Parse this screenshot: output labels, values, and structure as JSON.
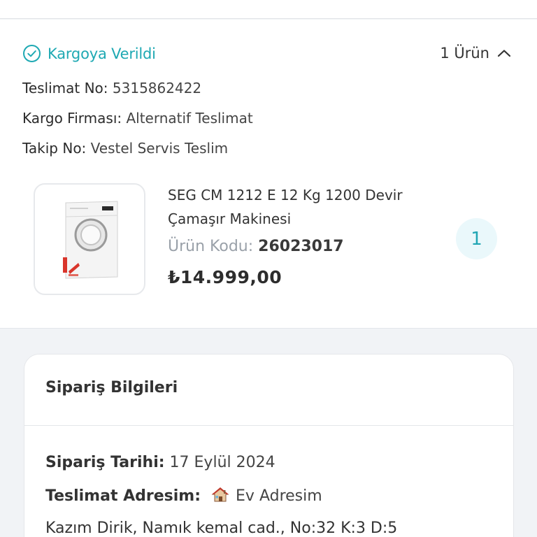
{
  "shipment": {
    "status": "Kargoya Verildi",
    "item_count": "1 Ürün",
    "delivery_no_label": "Teslimat No:",
    "delivery_no": "5315862422",
    "carrier_label": "Kargo Firması:",
    "carrier": "Alternatif Teslimat",
    "tracking_label": "Takip No:",
    "tracking": "Vestel Servis Teslim"
  },
  "product": {
    "name": "SEG CM 1212 E 12 Kg 1200 Devir Çamaşır Makinesi",
    "code_label": "Ürün Kodu:",
    "code": "26023017",
    "price": "₺14.999,00",
    "quantity": "1"
  },
  "order": {
    "title": "Sipariş Bilgileri",
    "date_label": "Sipariş Tarihi:",
    "date": "17 Eylül 2024",
    "address_label": "Teslimat Adresim:",
    "address_name": "Ev Adresim",
    "address_line": "Kazım Dirik, Namık kemal cad., No:32 K:3 D:5"
  },
  "colors": {
    "accent": "#1fa9b3",
    "badge_bg": "#eaf8fb",
    "page_bg": "#f1f3f6"
  },
  "icons": {
    "status": "check-circle-icon",
    "toggle": "chevron-up-icon",
    "address": "house-icon"
  }
}
